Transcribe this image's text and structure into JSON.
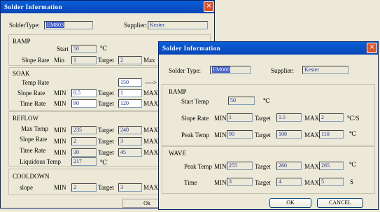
{
  "back": {
    "title": "Solder Information",
    "solder_type_label": "SolderType:",
    "solder_type_value": "EM803",
    "supplier_label": "Supplier:",
    "supplier_value": "Kester",
    "ramp": {
      "heading": "RAMP",
      "start_label": "Start",
      "start_value": "50",
      "start_unit": "℃",
      "slope_label": "Slope Rate",
      "min_label": "Min",
      "min_value": "1",
      "target_label": "Target",
      "target_value": "2",
      "max_label": "Max"
    },
    "soak": {
      "heading": "SOAK",
      "temp_rate_label": "Temp Rate",
      "temp_rate_value": "150",
      "arrow": "---->",
      "slope_label": "Slope Rate",
      "slope_min_label": "MIN",
      "slope_min": "0.5",
      "slope_target_label": "Target",
      "slope_target": "1",
      "slope_max_label": "MAX",
      "time_label": "Time Rate",
      "time_min_label": "MIN",
      "time_min": "90",
      "time_target_label": "Target",
      "time_target": "120",
      "time_max_label": "MAX"
    },
    "reflow": {
      "heading": "REFLOW",
      "max_temp_label": "Max Temp",
      "max_temp_min_label": "MIN",
      "max_temp_min": "235",
      "max_temp_target_label": "Target",
      "max_temp_target": "240",
      "max_temp_max_label": "MAX",
      "slope_label": "Slope Rate",
      "slope_min_label": "MIN",
      "slope_min": "2",
      "slope_target_label": "Target",
      "slope_target": "3",
      "slope_max_label": "MAX",
      "time_label": "Time Rate",
      "time_min_label": "MIN",
      "time_min": "30",
      "time_target_label": "Target",
      "time_target": "45",
      "time_max_label": "MAX",
      "liquidous_label": "Liquidous Temp",
      "liquidous_value": "217",
      "liquidous_unit": "℃"
    },
    "cooldown": {
      "heading": "COOLDOWN",
      "slope_label": "slope",
      "min_label": "MIN",
      "min_value": "2",
      "target_label": "Target",
      "target_value": "3",
      "max_label": "MAX"
    },
    "ok_label": "Ok"
  },
  "front": {
    "title": "Solder Information",
    "solder_type_label": "Solder Type:",
    "solder_type_value": "EM000",
    "supplier_label": "Supplier:",
    "supplier_value": "Kester",
    "ramp": {
      "heading": "RAMP",
      "start_label": "Start Temp",
      "start_value": "50",
      "start_unit": "℃",
      "slope_label": "Slope Rate",
      "slope_min_label": "MIN",
      "slope_min": "1",
      "slope_target_label": "Target",
      "slope_target": "1.5",
      "slope_max_label": "MAX",
      "slope_max": "2",
      "slope_unit": "℃/S",
      "peak_label": "Peak Temp",
      "peak_min_label": "MIN",
      "peak_min": "90",
      "peak_target_label": "Target",
      "peak_target": "100",
      "peak_max_label": "MAX",
      "peak_max": "110",
      "peak_unit": "℃"
    },
    "wave": {
      "heading": "WAVE",
      "peak_label": "Peak Temp",
      "peak_min_label": "MIN",
      "peak_min": "255",
      "peak_target_label": "Target",
      "peak_target": "260",
      "peak_max_label": "MAX",
      "peak_max": "265",
      "peak_unit": "℃",
      "time_label": "Time",
      "time_min_label": "MIN",
      "time_min": "3",
      "time_target_label": "Target",
      "time_target": "4",
      "time_max_label": "MAX",
      "time_max": "5",
      "time_unit": "S"
    },
    "ok_label": "OK",
    "cancel_label": "CANCEL"
  },
  "icons": {
    "close": "×"
  }
}
